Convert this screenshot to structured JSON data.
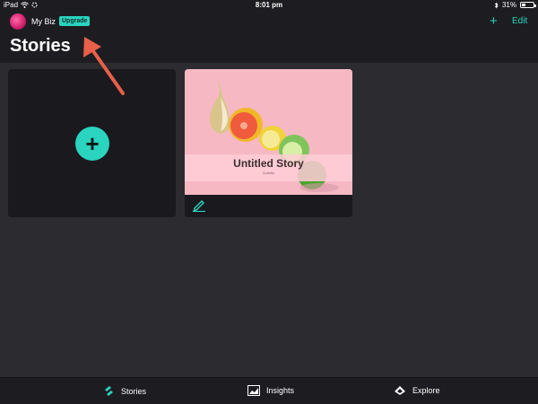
{
  "status_bar": {
    "device": "iPad",
    "time": "8:01 pm",
    "battery": "31%",
    "battery_level": 0.31
  },
  "header": {
    "account_name": "My Biz",
    "upgrade_label": "Upgrade",
    "add_label": "+",
    "edit_label": "Edit",
    "title": "Stories"
  },
  "cards": {
    "new_story_icon": "+",
    "story": {
      "title": "Untitled Story",
      "subtitle": "Subtitle"
    }
  },
  "tab_bar": {
    "tabs": [
      {
        "label": "Stories",
        "icon": "stories-icon"
      },
      {
        "label": "Insights",
        "icon": "insights-icon"
      },
      {
        "label": "Explore",
        "icon": "explore-icon"
      }
    ]
  },
  "colors": {
    "accent": "#2ad4bf",
    "background": "#2b2b30",
    "bar": "#1d1d21",
    "card": "#1a1a1e",
    "annotation_arrow": "#e8604a"
  }
}
